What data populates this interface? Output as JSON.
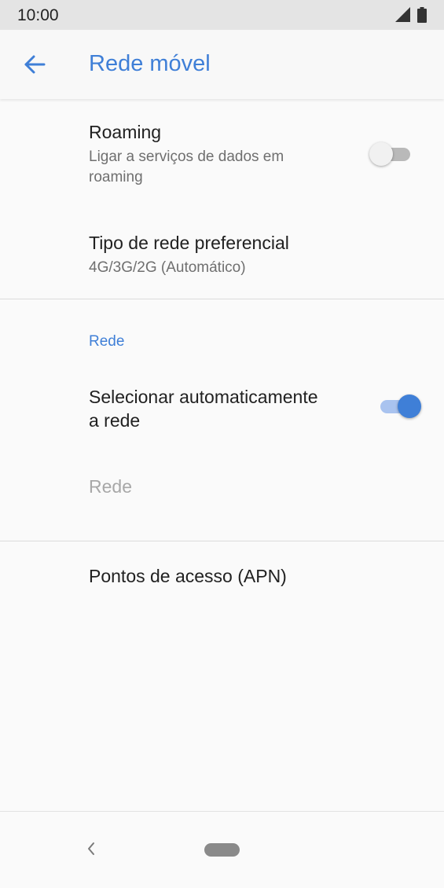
{
  "status_bar": {
    "time": "10:00",
    "icons": [
      "signal-icon",
      "battery-icon"
    ]
  },
  "app_bar": {
    "title": "Rede móvel",
    "back_icon": "arrow-back-icon"
  },
  "settings": {
    "roaming": {
      "title": "Roaming",
      "summary_line1": "Ligar a serviços de dados em",
      "summary_line2": "roaming",
      "toggle_state": "off"
    },
    "preferred_network": {
      "title": "Tipo de rede preferencial",
      "summary": "4G/3G/2G (Automático)"
    },
    "network_section": {
      "header": "Rede",
      "auto_select": {
        "title_line1": "Selecionar automaticamente",
        "title_line2": "a rede",
        "toggle_state": "on"
      },
      "network_item": {
        "title": "Rede",
        "enabled": false
      }
    },
    "apn": {
      "title": "Pontos de acesso (APN)"
    }
  },
  "nav_bar": {
    "back_icon": "nav-back-icon",
    "home_icon": "nav-home-pill"
  },
  "colors": {
    "accent": "#3f7fd7",
    "status_bar_bg": "#e4e4e4",
    "background": "#fafafa"
  }
}
